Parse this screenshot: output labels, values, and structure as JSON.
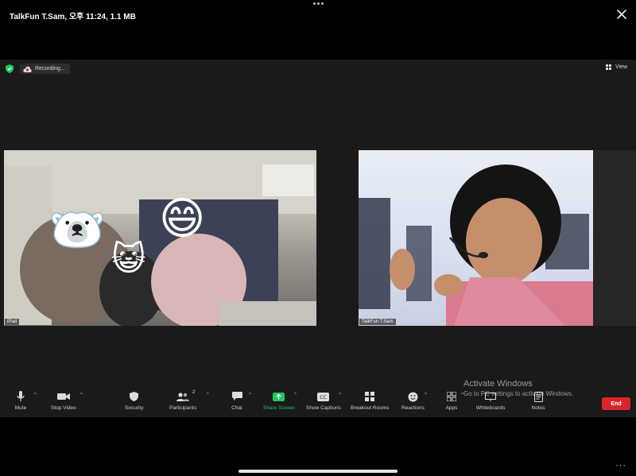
{
  "window": {
    "title": "TalkFun T.Sam, 오후 11:24, 1.1 MB",
    "more_icon": "more-dots-icon",
    "close_icon": "close-icon"
  },
  "meeting": {
    "recording_label": "Recording...",
    "view_label": "View",
    "participants": [
      {
        "name": "iPad",
        "stickers": [
          "🐻‍❄️",
          "😺",
          "😄"
        ]
      },
      {
        "name": "TalkFun T.Sam"
      }
    ]
  },
  "toolbar": {
    "mute": "Mute",
    "stop_video": "Stop Video",
    "security": "Security",
    "participants": "Participants",
    "participants_count": "2",
    "chat": "Chat",
    "share_screen": "Share Screen",
    "show_captions": "Show Captions",
    "breakout_rooms": "Breakout Rooms",
    "reactions": "Reactions",
    "apps": "Apps",
    "whiteboards": "Whiteboards",
    "notes": "Notes",
    "end": "End",
    "share_color": "#22c55e",
    "end_color": "#d9262c"
  },
  "watermark": {
    "title": "Activate Windows",
    "subtitle": "Go to PC settings to activate Windows."
  },
  "bottom": {
    "more_label": "···"
  }
}
